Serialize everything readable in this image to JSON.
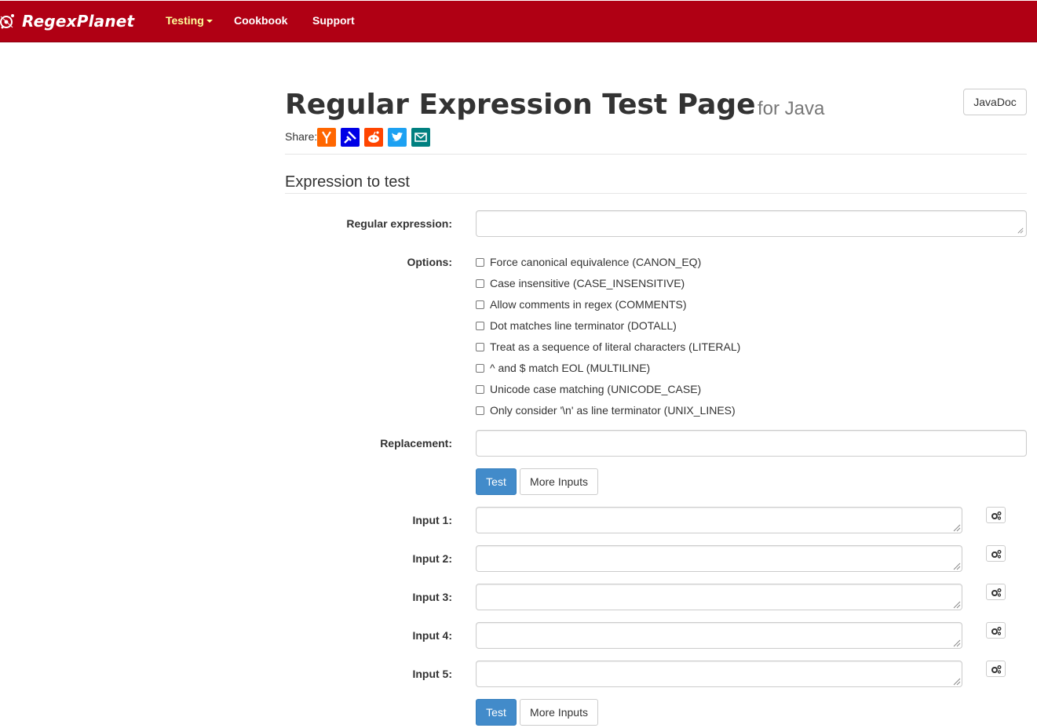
{
  "brand": {
    "name": "RegexPlanet"
  },
  "nav": {
    "testing": "Testing",
    "cookbook": "Cookbook",
    "support": "Support"
  },
  "header": {
    "title": "Regular Expression Test Page",
    "subtitle": "for Java",
    "javadoc_label": "JavaDoc",
    "share_label": "Share:",
    "share_icons": [
      "hacker-news-icon",
      "pinboard-icon",
      "reddit-icon",
      "twitter-icon",
      "email-icon"
    ]
  },
  "section": {
    "title": "Expression to test"
  },
  "form": {
    "regex_label": "Regular expression:",
    "regex_value": "",
    "options_label": "Options:",
    "options": [
      "Force canonical equivalence (CANON_EQ)",
      "Case insensitive (CASE_INSENSITIVE)",
      "Allow comments in regex (COMMENTS)",
      "Dot matches line terminator (DOTALL)",
      "Treat as a sequence of literal characters (LITERAL)",
      "^ and $ match EOL (MULTILINE)",
      "Unicode case matching (UNICODE_CASE)",
      "Only consider '\\n' as line terminator (UNIX_LINES)"
    ],
    "replacement_label": "Replacement:",
    "replacement_value": "",
    "test_label": "Test",
    "more_inputs_label": "More Inputs",
    "inputs": [
      {
        "label": "Input 1:",
        "value": ""
      },
      {
        "label": "Input 2:",
        "value": ""
      },
      {
        "label": "Input 3:",
        "value": ""
      },
      {
        "label": "Input 4:",
        "value": ""
      },
      {
        "label": "Input 5:",
        "value": ""
      }
    ]
  },
  "colors": {
    "navbar": "#b00014",
    "nav_active": "#ffff99",
    "primary_button": "#428bca"
  }
}
